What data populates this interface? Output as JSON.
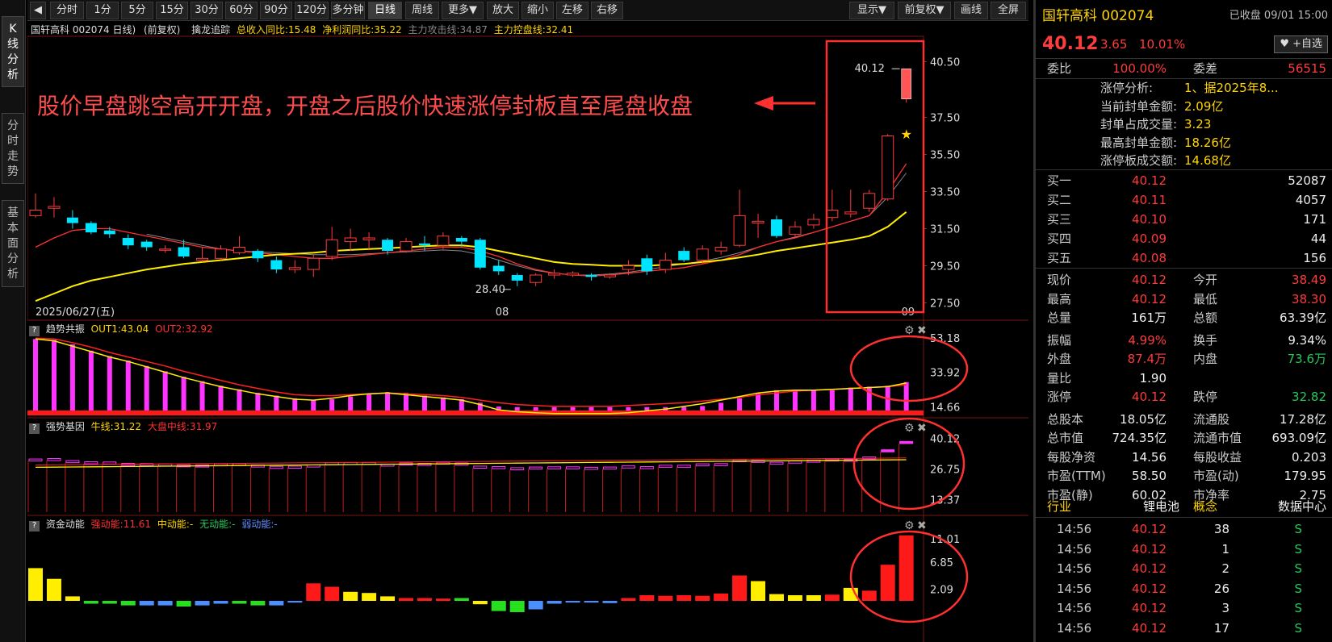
{
  "left_tabs": [
    "K\n线\n分\n析",
    "分\n时\n走\n势",
    "基\n本\n面\n分\n析"
  ],
  "toolbar": {
    "nav_icon": "◀",
    "periods": [
      "分时",
      "1分",
      "5分",
      "15分",
      "30分",
      "60分",
      "90分",
      "120分",
      "多分钟",
      "日线",
      "周线",
      "更多▼",
      "放大",
      "缩小",
      "左移",
      "右移"
    ],
    "right_buttons": [
      "显示▼",
      "前复权▼",
      "画线",
      "全屏"
    ]
  },
  "main_header": {
    "symbol": "国轩高科 002074 日线)",
    "adj": "(前复权)",
    "indicator": "擒龙追踪",
    "m1": "总收入同比:15.48",
    "m2": "净利润同比:35.22",
    "m3": "主力攻击线:34.87",
    "m4": "主力控盘线:32.41"
  },
  "price_axis": [
    "40.50",
    "37.50",
    "35.50",
    "33.50",
    "31.50",
    "29.50",
    "27.50"
  ],
  "date_labels": [
    "2025/06/27(五)",
    "08",
    "09"
  ],
  "annotation": "股价早盘跳空高开开盘，开盘之后股价快速涨停封板直至尾盘收盘",
  "price_labels": {
    "high": "40.12",
    "low": "28.40"
  },
  "panel2": {
    "name": "趋势共振",
    "out1": "OUT1:43.04",
    "out2": "OUT2:32.92",
    "axis": [
      "53.18",
      "33.92",
      "14.66"
    ]
  },
  "panel3": {
    "name": "强势基因",
    "l1": "牛线:31.22",
    "l2": "大盘中线:31.97",
    "axis": [
      "40.12",
      "26.75",
      "13.37"
    ]
  },
  "panel4": {
    "name": "资金动能",
    "s1": "强动能:11.61",
    "s2": "中动能:-",
    "s3": "无动能:-",
    "s4": "弱动能:-",
    "axis": [
      "11.01",
      "6.85",
      "2.09"
    ]
  },
  "colors": {
    "up": "#ff3b3b",
    "down": "#00e5ff",
    "ma_long": "#ffee00",
    "ma_short": "#ff3030",
    "annot": "#ff4d4d",
    "magenta": "#ff33ff"
  },
  "quote": {
    "name_code": "国轩高科 002074",
    "status": "已收盘 09/01 15:00",
    "price": "40.12",
    "change": "3.65",
    "pct": "10.01%",
    "watch_btn": "♥ +自选",
    "weibi_lbl": "委比",
    "weibi": "100.00%",
    "weicha_lbl": "委差",
    "weicha": "56515",
    "limit_rows": [
      {
        "k": "涨停分析:",
        "v": "1、据2025年8..."
      },
      {
        "k": "当前封单金额:",
        "v": "2.09亿"
      },
      {
        "k": "封单占成交量:",
        "v": "3.23"
      },
      {
        "k": "最高封单金额:",
        "v": "18.26亿"
      },
      {
        "k": "涨停板成交额:",
        "v": "14.68亿"
      }
    ],
    "buy": [
      {
        "k": "买一",
        "p": "40.12",
        "v": "52087"
      },
      {
        "k": "买二",
        "p": "40.11",
        "v": "4057"
      },
      {
        "k": "买三",
        "p": "40.10",
        "v": "171"
      },
      {
        "k": "买四",
        "p": "40.09",
        "v": "44"
      },
      {
        "k": "买五",
        "p": "40.08",
        "v": "156"
      }
    ],
    "stats": [
      {
        "k1": "现价",
        "v1": "40.12",
        "c1": "red",
        "k2": "今开",
        "v2": "38.49",
        "c2": "red"
      },
      {
        "k1": "最高",
        "v1": "40.12",
        "c1": "red",
        "k2": "最低",
        "v2": "38.30",
        "c2": "red"
      },
      {
        "k1": "总量",
        "v1": "161万",
        "c1": "white",
        "k2": "总额",
        "v2": "63.39亿",
        "c2": "white"
      },
      {
        "k1": "振幅",
        "v1": "4.99%",
        "c1": "red",
        "k2": "换手",
        "v2": "9.34%",
        "c2": "white"
      },
      {
        "k1": "外盘",
        "v1": "87.4万",
        "c1": "red",
        "k2": "内盘",
        "v2": "73.6万",
        "c2": "green"
      },
      {
        "k1": "量比",
        "v1": "1.90",
        "c1": "white",
        "k2": "",
        "v2": "",
        "c2": "white"
      },
      {
        "k1": "涨停",
        "v1": "40.12",
        "c1": "red",
        "k2": "跌停",
        "v2": "32.82",
        "c2": "green"
      },
      {
        "k1": "总股本",
        "v1": "18.05亿",
        "c1": "white",
        "k2": "流通股",
        "v2": "17.28亿",
        "c2": "white"
      },
      {
        "k1": "总市值",
        "v1": "724.35亿",
        "c1": "white",
        "k2": "流通市值",
        "v2": "693.09亿",
        "c2": "white"
      },
      {
        "k1": "每股净资",
        "v1": "14.56",
        "c1": "white",
        "k2": "每股收益",
        "v2": "0.203",
        "c2": "white"
      },
      {
        "k1": "市盈(TTM)",
        "v1": "58.50",
        "c1": "white",
        "k2": "市盈(动)",
        "v2": "179.95",
        "c2": "white"
      },
      {
        "k1": "市盈(静)",
        "v1": "60.02",
        "c1": "white",
        "k2": "市净率",
        "v2": "2.75",
        "c2": "white"
      }
    ],
    "industry": {
      "k1": "行业",
      "v1": "锂电池",
      "k2": "概念",
      "v2": "数据中心"
    },
    "ticks": [
      {
        "t": "14:56",
        "p": "40.12",
        "v": "38",
        "s": "S"
      },
      {
        "t": "14:56",
        "p": "40.12",
        "v": "1",
        "s": "S"
      },
      {
        "t": "14:56",
        "p": "40.12",
        "v": "2",
        "s": "S"
      },
      {
        "t": "14:56",
        "p": "40.12",
        "v": "26",
        "s": "S"
      },
      {
        "t": "14:56",
        "p": "40.12",
        "v": "3",
        "s": "S"
      },
      {
        "t": "14:56",
        "p": "40.12",
        "v": "17",
        "s": "S"
      }
    ]
  },
  "chart_data": {
    "type": "candlestick",
    "ylim": [
      27.0,
      41.0
    ],
    "candles": [
      {
        "o": 32.2,
        "c": 32.5,
        "h": 33.4,
        "l": 32.1
      },
      {
        "o": 32.6,
        "c": 32.7,
        "h": 33.2,
        "l": 32.1
      },
      {
        "o": 32.1,
        "c": 31.8,
        "h": 32.5,
        "l": 31.5
      },
      {
        "o": 31.8,
        "c": 31.3,
        "h": 31.9,
        "l": 31.2
      },
      {
        "o": 31.4,
        "c": 31.2,
        "h": 31.6,
        "l": 31.0
      },
      {
        "o": 31.0,
        "c": 30.6,
        "h": 31.2,
        "l": 30.4
      },
      {
        "o": 30.8,
        "c": 30.5,
        "h": 30.9,
        "l": 30.3
      },
      {
        "o": 30.4,
        "c": 30.4,
        "h": 30.6,
        "l": 30.2
      },
      {
        "o": 30.5,
        "c": 30.0,
        "h": 30.9,
        "l": 29.9
      },
      {
        "o": 29.8,
        "c": 29.9,
        "h": 30.5,
        "l": 29.7
      },
      {
        "o": 29.9,
        "c": 30.4,
        "h": 30.6,
        "l": 29.8
      },
      {
        "o": 30.2,
        "c": 30.5,
        "h": 31.1,
        "l": 30.1
      },
      {
        "o": 30.3,
        "c": 29.9,
        "h": 30.4,
        "l": 29.7
      },
      {
        "o": 29.8,
        "c": 29.3,
        "h": 30.0,
        "l": 29.1
      },
      {
        "o": 29.3,
        "c": 29.4,
        "h": 29.8,
        "l": 29.1
      },
      {
        "o": 29.3,
        "c": 29.9,
        "h": 30.1,
        "l": 28.9
      },
      {
        "o": 30.0,
        "c": 30.9,
        "h": 31.6,
        "l": 29.8
      },
      {
        "o": 30.8,
        "c": 31.0,
        "h": 31.5,
        "l": 30.3
      },
      {
        "o": 30.9,
        "c": 31.0,
        "h": 31.3,
        "l": 30.4
      },
      {
        "o": 30.9,
        "c": 30.3,
        "h": 31.0,
        "l": 30.1
      },
      {
        "o": 30.3,
        "c": 30.8,
        "h": 31.0,
        "l": 30.2
      },
      {
        "o": 30.7,
        "c": 30.6,
        "h": 31.1,
        "l": 30.3
      },
      {
        "o": 30.6,
        "c": 31.1,
        "h": 31.3,
        "l": 30.4
      },
      {
        "o": 31.0,
        "c": 30.8,
        "h": 31.1,
        "l": 30.5
      },
      {
        "o": 30.9,
        "c": 29.4,
        "h": 31.0,
        "l": 29.3
      },
      {
        "o": 29.5,
        "c": 29.2,
        "h": 29.8,
        "l": 29.0
      },
      {
        "o": 29.0,
        "c": 28.7,
        "h": 29.1,
        "l": 28.4
      },
      {
        "o": 28.6,
        "c": 29.0,
        "h": 29.1,
        "l": 28.4
      },
      {
        "o": 29.0,
        "c": 29.1,
        "h": 29.3,
        "l": 28.8
      },
      {
        "o": 29.0,
        "c": 29.1,
        "h": 29.2,
        "l": 28.9
      },
      {
        "o": 29.0,
        "c": 28.9,
        "h": 29.1,
        "l": 28.7
      },
      {
        "o": 28.9,
        "c": 29.0,
        "h": 29.1,
        "l": 28.8
      },
      {
        "o": 29.3,
        "c": 29.5,
        "h": 29.8,
        "l": 29.0
      },
      {
        "o": 29.9,
        "c": 29.2,
        "h": 30.1,
        "l": 29.0
      },
      {
        "o": 29.3,
        "c": 29.8,
        "h": 30.2,
        "l": 29.1
      },
      {
        "o": 30.3,
        "c": 29.8,
        "h": 30.5,
        "l": 29.7
      },
      {
        "o": 29.8,
        "c": 30.4,
        "h": 30.6,
        "l": 29.6
      },
      {
        "o": 30.3,
        "c": 30.5,
        "h": 30.8,
        "l": 30.1
      },
      {
        "o": 30.6,
        "c": 32.2,
        "h": 33.6,
        "l": 30.5
      },
      {
        "o": 31.8,
        "c": 31.9,
        "h": 32.3,
        "l": 31.0
      },
      {
        "o": 32.0,
        "c": 31.1,
        "h": 32.2,
        "l": 31.0
      },
      {
        "o": 31.2,
        "c": 31.6,
        "h": 31.9,
        "l": 31.0
      },
      {
        "o": 31.7,
        "c": 32.0,
        "h": 32.3,
        "l": 31.5
      },
      {
        "o": 32.1,
        "c": 32.5,
        "h": 33.6,
        "l": 31.9
      },
      {
        "o": 32.3,
        "c": 32.4,
        "h": 33.6,
        "l": 32.1
      },
      {
        "o": 32.6,
        "c": 33.4,
        "h": 33.6,
        "l": 32.4
      },
      {
        "o": 33.1,
        "c": 36.5,
        "h": 36.6,
        "l": 33.0
      },
      {
        "o": 38.49,
        "c": 40.12,
        "h": 40.12,
        "l": 38.3
      }
    ],
    "ma_long": [
      27.6,
      28.0,
      28.4,
      28.7,
      28.9,
      29.1,
      29.3,
      29.45,
      29.6,
      29.7,
      29.8,
      29.9,
      30.0,
      30.1,
      30.15,
      30.2,
      30.3,
      30.35,
      30.4,
      30.45,
      30.5,
      30.55,
      30.6,
      30.6,
      30.5,
      30.3,
      30.1,
      29.9,
      29.7,
      29.6,
      29.55,
      29.5,
      29.5,
      29.5,
      29.55,
      29.6,
      29.7,
      29.8,
      29.95,
      30.1,
      30.3,
      30.45,
      30.6,
      30.75,
      30.9,
      31.1,
      31.6,
      32.4
    ],
    "ma_short": [
      30.5,
      31.0,
      31.4,
      31.5,
      31.5,
      31.3,
      31.1,
      30.9,
      30.7,
      30.5,
      30.4,
      30.3,
      30.2,
      30.1,
      30.0,
      29.9,
      29.9,
      30.0,
      30.1,
      30.2,
      30.3,
      30.4,
      30.5,
      30.5,
      30.3,
      30.0,
      29.6,
      29.3,
      29.1,
      29.0,
      28.95,
      29.0,
      29.1,
      29.2,
      29.3,
      29.4,
      29.6,
      29.8,
      30.1,
      30.5,
      30.8,
      31.0,
      31.3,
      31.6,
      31.9,
      32.2,
      33.5,
      35.0
    ],
    "ma_grey": [
      null,
      null,
      null,
      null,
      null,
      null,
      31.2,
      31.0,
      30.8,
      30.6,
      30.4,
      30.3,
      30.25,
      30.2,
      30.15,
      30.1,
      30.1,
      30.1,
      30.15,
      30.2,
      30.25,
      30.3,
      30.35,
      30.3,
      30.1,
      29.8,
      29.5,
      29.25,
      29.1,
      29.0,
      29.0,
      29.05,
      29.15,
      29.3,
      29.45,
      29.6,
      29.75,
      29.95,
      30.2,
      30.5,
      30.8,
      31.05,
      31.3,
      31.6,
      31.9,
      32.2,
      33.2,
      34.5
    ],
    "trend_bars": [
      52.5,
      52.0,
      49.5,
      46.0,
      43.0,
      40.5,
      37.5,
      34.5,
      31.5,
      29.0,
      26.5,
      24.5,
      22.5,
      21.0,
      19.5,
      18.5,
      19.0,
      20.5,
      22.0,
      23.0,
      22.5,
      21.0,
      20.0,
      19.0,
      17.0,
      14.9,
      14.6,
      14.6,
      14.6,
      14.6,
      14.6,
      14.6,
      14.6,
      14.6,
      14.6,
      14.6,
      15.2,
      17.0,
      19.5,
      22.5,
      24.0,
      24.0,
      24.0,
      24.0,
      25.5,
      26.0,
      26.5,
      28.5,
      34.5,
      44.0
    ],
    "trend_out1": [
      52.5,
      51.5,
      48.5,
      45.5,
      42.5,
      40.0,
      37.0,
      34.0,
      31.0,
      28.5,
      26.0,
      24.0,
      22.0,
      20.5,
      19.0,
      18.5,
      19.5,
      21.0,
      22.0,
      22.5,
      21.5,
      20.5,
      19.5,
      18.5,
      16.0,
      13.0,
      12.0,
      11.5,
      11.0,
      11.0,
      11.0,
      11.0,
      11.5,
      12.5,
      13.5,
      15.0,
      16.5,
      18.5,
      20.5,
      22.5,
      23.5,
      24.0,
      24.0,
      24.5,
      25.0,
      25.5,
      26.0,
      28.0,
      33.0,
      43.0
    ],
    "trend_out2": [
      53.0,
      52.5,
      50.5,
      48.0,
      45.0,
      42.5,
      40.0,
      37.5,
      34.5,
      32.0,
      29.5,
      27.0,
      25.0,
      23.0,
      21.5,
      21.0,
      21.0,
      21.5,
      22.0,
      22.5,
      22.0,
      21.5,
      21.0,
      20.0,
      18.5,
      17.0,
      16.0,
      15.5,
      15.0,
      15.0,
      15.0,
      15.0,
      15.5,
      16.0,
      16.5,
      17.0,
      18.0,
      19.0,
      20.0,
      21.5,
      22.5,
      23.5,
      24.0,
      24.5,
      25.0,
      25.5,
      26.0,
      27.0,
      30.0,
      33.0
    ],
    "gene_boxes": [
      32.5,
      32.7,
      31.8,
      31.3,
      31.2,
      30.6,
      30.5,
      30.4,
      30.0,
      29.9,
      30.4,
      30.5,
      29.9,
      29.3,
      29.4,
      29.9,
      30.9,
      31.0,
      31.0,
      30.3,
      30.8,
      30.6,
      31.1,
      30.8,
      29.4,
      29.2,
      28.7,
      29.0,
      29.1,
      29.1,
      28.9,
      29.0,
      29.5,
      29.2,
      29.8,
      29.8,
      30.4,
      30.5,
      32.2,
      31.9,
      31.1,
      31.6,
      32.0,
      32.5,
      32.4,
      33.4,
      36.5,
      40.12
    ],
    "energy": [
      5.8,
      3.9,
      0.8,
      -0.5,
      -0.5,
      -0.8,
      -0.8,
      -0.8,
      -1.0,
      -0.8,
      -0.5,
      -0.5,
      -0.8,
      -0.8,
      -0.3,
      3.1,
      2.5,
      1.6,
      1.4,
      0.8,
      0.5,
      0.5,
      0.4,
      0.5,
      -0.6,
      -1.8,
      -2.0,
      -1.5,
      -0.5,
      -0.3,
      -0.3,
      -0.4,
      0.5,
      1.0,
      0.9,
      1.0,
      0.9,
      1.3,
      4.5,
      3.5,
      1.2,
      1.0,
      1.0,
      1.1,
      2.3,
      1.8,
      6.4,
      11.61
    ],
    "energy_colors": [
      "yellow",
      "yellow",
      "yellow",
      "green",
      "green",
      "green",
      "blue",
      "blue",
      "green",
      "blue",
      "blue",
      "green",
      "green",
      "blue",
      "blue",
      "red",
      "red",
      "yellow",
      "yellow",
      "yellow",
      "red",
      "red",
      "red",
      "green",
      "yellow",
      "green",
      "green",
      "blue",
      "blue",
      "blue",
      "blue",
      "blue",
      "red",
      "red",
      "red",
      "red",
      "red",
      "red",
      "red",
      "yellow",
      "yellow",
      "yellow",
      "yellow",
      "red",
      "yellow",
      "red",
      "red",
      "red"
    ]
  }
}
